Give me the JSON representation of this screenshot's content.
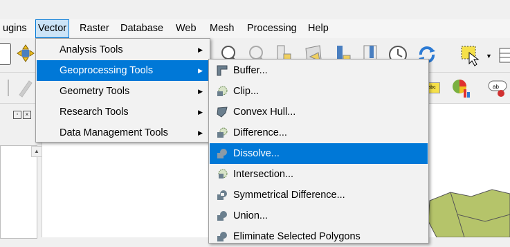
{
  "menubar": {
    "items": [
      {
        "label": "ugins"
      },
      {
        "label": "Vector"
      },
      {
        "label": "Raster"
      },
      {
        "label": "Database"
      },
      {
        "label": "Web"
      },
      {
        "label": "Mesh"
      },
      {
        "label": "Processing"
      },
      {
        "label": "Help"
      }
    ]
  },
  "vector_menu": {
    "items": [
      {
        "label": "Analysis Tools"
      },
      {
        "label": "Geoprocessing Tools"
      },
      {
        "label": "Geometry Tools"
      },
      {
        "label": "Research Tools"
      },
      {
        "label": "Data Management Tools"
      }
    ],
    "selected": "Geoprocessing Tools"
  },
  "geoprocessing_menu": {
    "items": [
      {
        "label": "Buffer...",
        "icon": "buffer-icon"
      },
      {
        "label": "Clip...",
        "icon": "clip-icon"
      },
      {
        "label": "Convex Hull...",
        "icon": "convex-hull-icon"
      },
      {
        "label": "Difference...",
        "icon": "difference-icon"
      },
      {
        "label": "Dissolve...",
        "icon": "dissolve-icon"
      },
      {
        "label": "Intersection...",
        "icon": "intersection-icon"
      },
      {
        "label": "Symmetrical Difference...",
        "icon": "symmetrical-difference-icon"
      },
      {
        "label": "Union...",
        "icon": "union-icon"
      },
      {
        "label": "Eliminate Selected Polygons",
        "icon": "eliminate-icon"
      }
    ],
    "selected": "Dissolve..."
  },
  "toolbar": {
    "label_badge": "abc",
    "label_badge2": "ab"
  },
  "colors": {
    "accent": "#0078d7",
    "menu_bg": "#f2f2f2",
    "canvas_poly": "#b5c46a"
  }
}
